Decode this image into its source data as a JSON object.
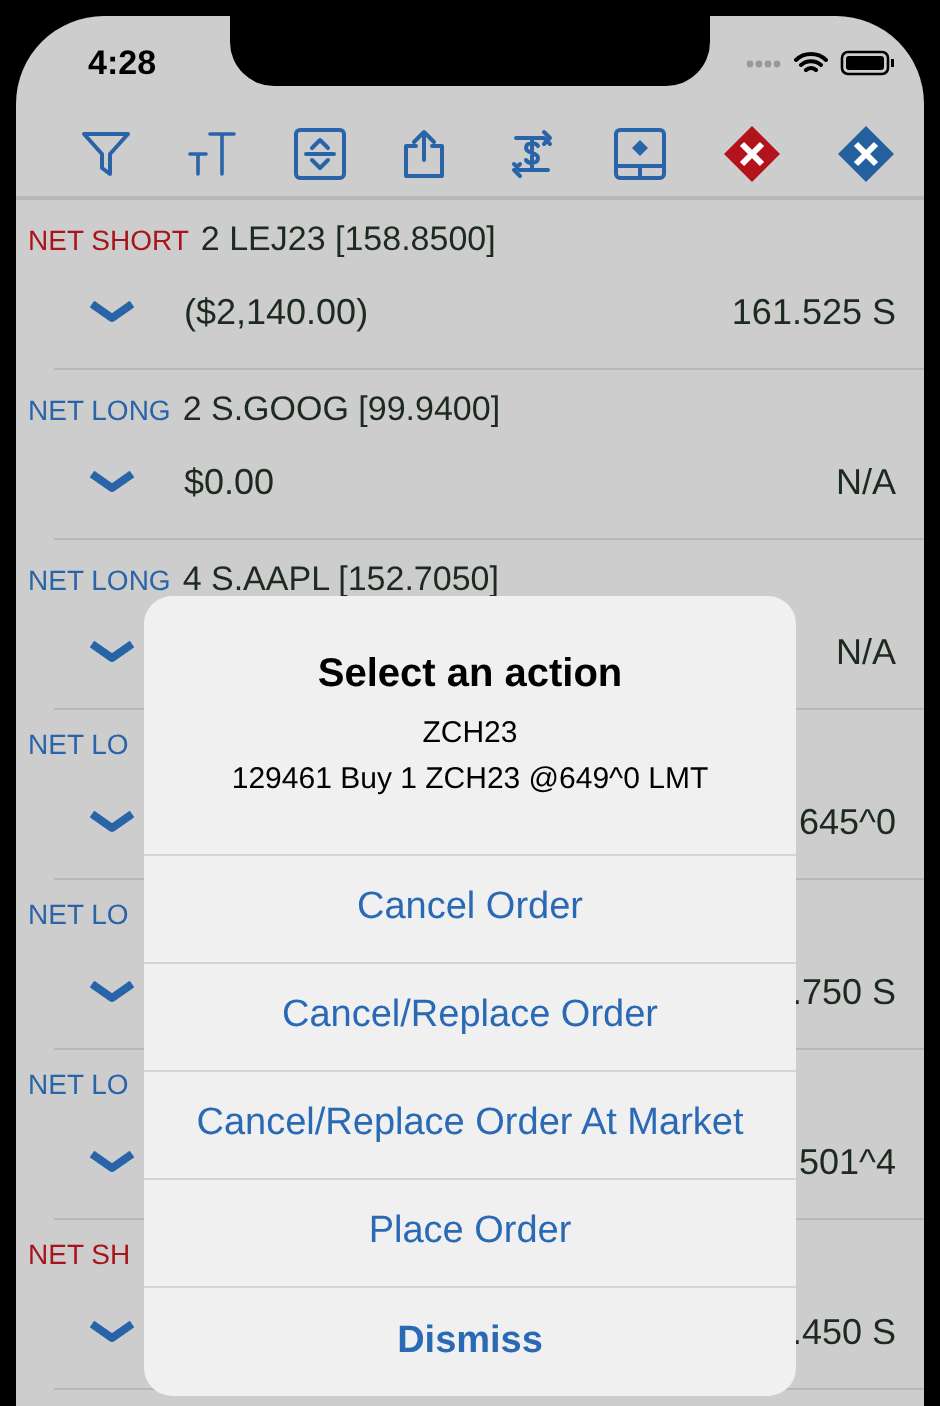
{
  "status_bar": {
    "time": "4:28"
  },
  "toolbar": {
    "buttons": [
      {
        "kind": "filter"
      },
      {
        "kind": "text-size"
      },
      {
        "kind": "expand"
      },
      {
        "kind": "share"
      },
      {
        "kind": "exchange"
      },
      {
        "kind": "panel"
      },
      {
        "kind": "cancel-red"
      },
      {
        "kind": "cancel-blue"
      }
    ]
  },
  "positions": [
    {
      "color": "#a8141a",
      "label": "NET SHORT",
      "name": "2 LEJ23 [158.8500]",
      "value_left": "($2,140.00)",
      "value_right": "161.525 S"
    },
    {
      "color": "#2a64a8",
      "label": "NET LONG",
      "name": "2 S.GOOG [99.9400]",
      "value_left": "$0.00",
      "value_right": "N/A"
    },
    {
      "color": "#2a64a8",
      "label": "NET LONG",
      "name": "4 S.AAPL [152.7050]",
      "value_right": "N/A"
    },
    {
      "color": "#2a64a8",
      "label": "NET LO",
      "value_right": "645^0"
    },
    {
      "color": "#2a64a8",
      "label": "NET LO",
      "value_right": ".750 S"
    },
    {
      "color": "#2a64a8",
      "label": "NET LO",
      "value_right": "501^4"
    },
    {
      "color": "#a8141a",
      "label": "NET SH",
      "value_right": ".450 S"
    }
  ],
  "action_sheet": {
    "title": "Select an action",
    "subtitle": "ZCH23",
    "detail": "129461 Buy 1 ZCH23 @649^0 LMT",
    "actions": [
      {
        "label": "Cancel Order",
        "kind": "normal"
      },
      {
        "label": "Cancel/Replace Order",
        "kind": "normal"
      },
      {
        "label": "Cancel/Replace Order At Market",
        "kind": "normal"
      },
      {
        "label": "Place Order",
        "kind": "normal"
      },
      {
        "label": "Dismiss",
        "kind": "cancel"
      }
    ]
  }
}
